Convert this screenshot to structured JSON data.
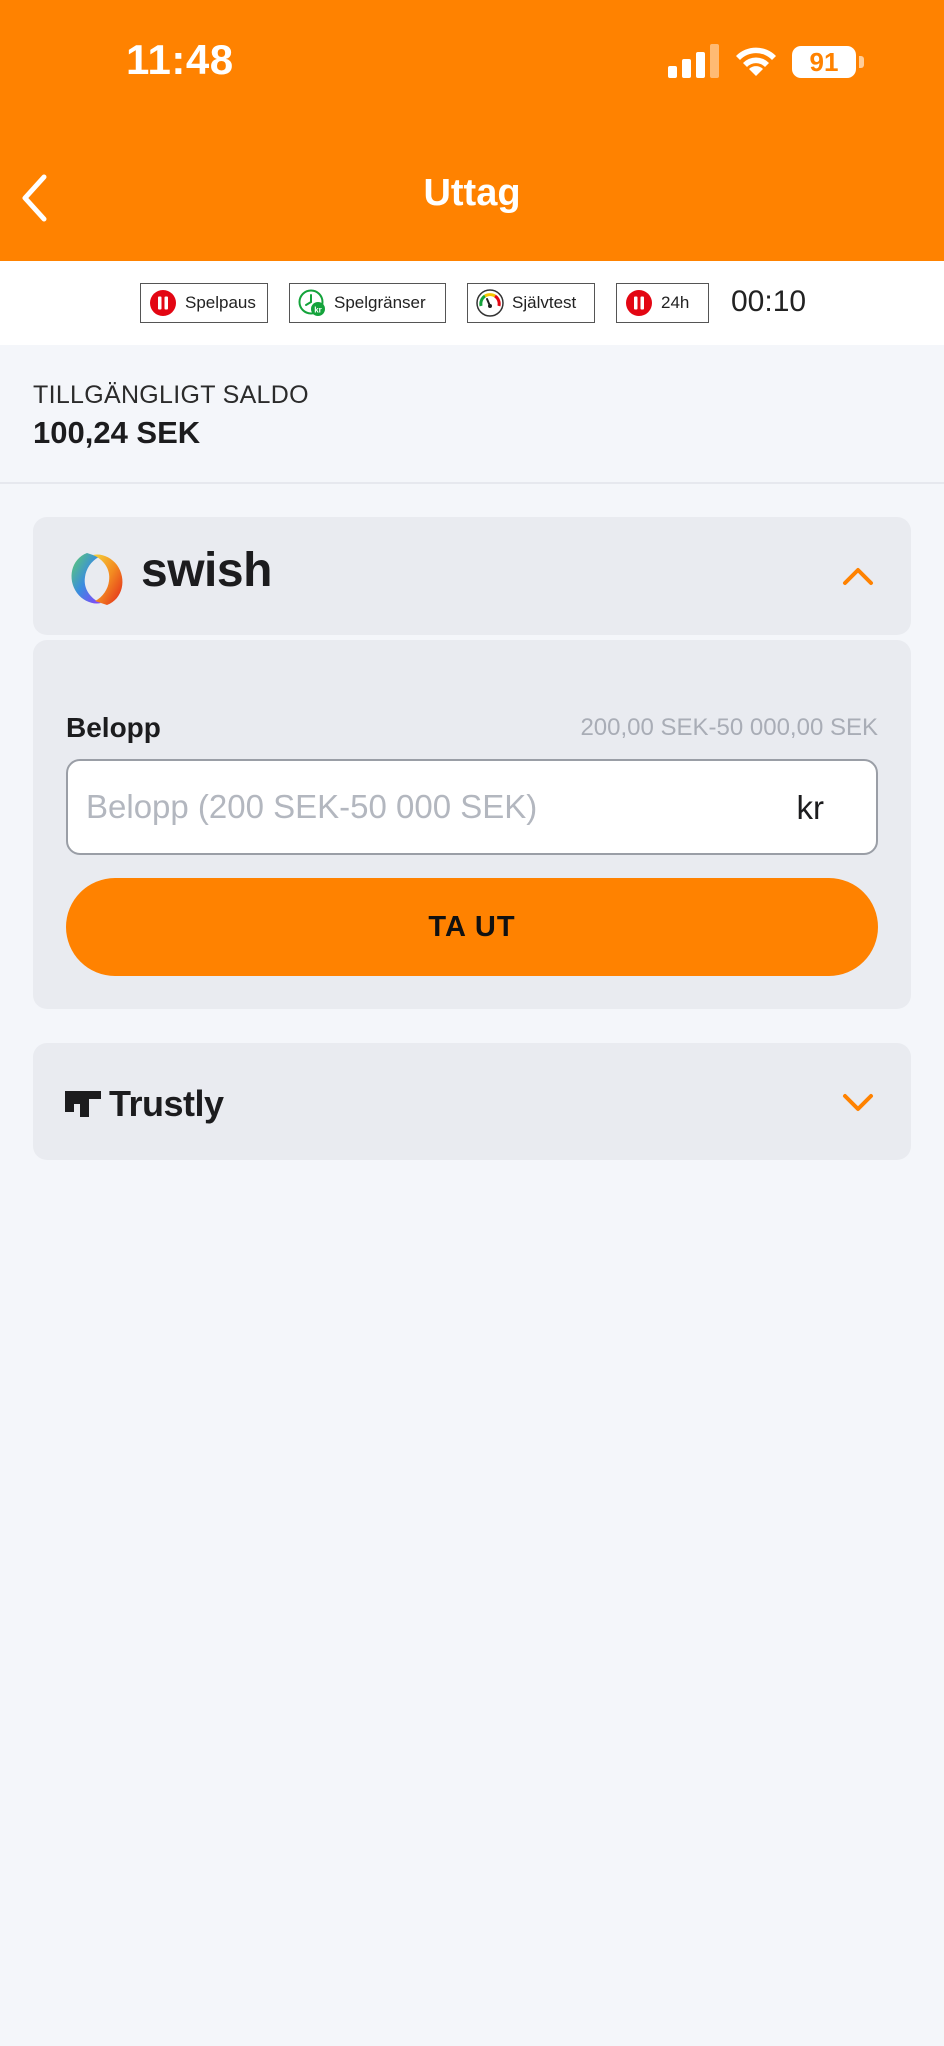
{
  "status_bar": {
    "time": "11:48",
    "battery": "91"
  },
  "header": {
    "title": "Uttag"
  },
  "rg_bar": {
    "items": [
      {
        "label": "Spelpaus"
      },
      {
        "label": "Spelgränser"
      },
      {
        "label": "Självtest"
      },
      {
        "label": "24h"
      }
    ],
    "timer": "00:10"
  },
  "balance": {
    "label": "TILLGÄNGLIGT SALDO",
    "value": "100,24 SEK"
  },
  "swish": {
    "name": "swish",
    "amount_label": "Belopp",
    "amount_range": "200,00 SEK-50 000,00 SEK",
    "amount_placeholder": "Belopp (200 SEK-50 000 SEK)",
    "amount_suffix": "kr",
    "submit_label": "TA UT"
  },
  "trustly": {
    "name": "Trustly"
  },
  "colors": {
    "brand": "#ff8200",
    "background": "#f4f6fa",
    "card": "#e9ebf0"
  }
}
